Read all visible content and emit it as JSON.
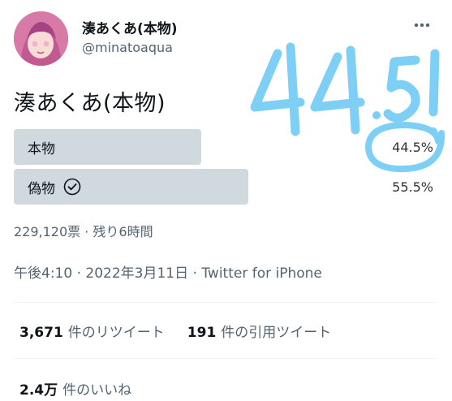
{
  "author": {
    "display_name": "湊あくあ(本物)",
    "username": "@minatoaqua"
  },
  "tweet": {
    "text": "湊あくあ(本物)"
  },
  "poll": {
    "options": [
      {
        "label": "本物",
        "percent_text": "44.5%",
        "fraction": 0.445,
        "winner": false
      },
      {
        "label": "偽物",
        "percent_text": "55.5%",
        "fraction": 0.555,
        "winner": true
      }
    ],
    "meta": "229,120票 · 残り6時間"
  },
  "timestamp": {
    "time": "午後4:10",
    "date": "2022年3月11日",
    "source": "Twitter for iPhone"
  },
  "stats": {
    "retweets_count": "3,671",
    "retweets_label": "件のリツイート",
    "quotes_count": "191",
    "quotes_label": "件の引用ツイート",
    "likes_count": "2.4万",
    "likes_label": "件のいいね"
  },
  "annotation": {
    "text": "44.5!",
    "color": "#7ecff5"
  },
  "icons": {
    "more": "more-horizontal-icon",
    "check": "check-circle-icon"
  }
}
